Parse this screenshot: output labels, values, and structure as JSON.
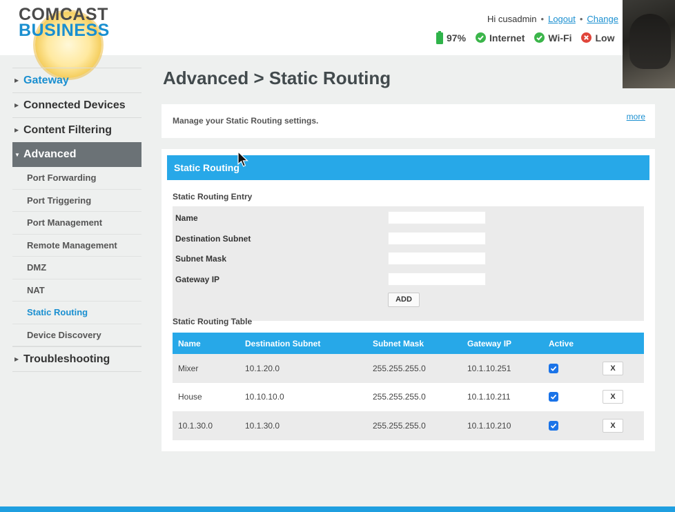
{
  "header": {
    "logo_line1": "COMCAST",
    "logo_line2": "BUSINESS",
    "greeting": "Hi cusadmin",
    "logout_label": "Logout",
    "change_label": "Change",
    "battery": "97%",
    "internet_label": "Internet",
    "wifi_label": "Wi-Fi",
    "low_label": "Low"
  },
  "sidebar": {
    "items": [
      {
        "label": "Gateway"
      },
      {
        "label": "Connected Devices"
      },
      {
        "label": "Content Filtering"
      },
      {
        "label": "Advanced"
      },
      {
        "label": "Troubleshooting"
      }
    ],
    "sub_items": [
      {
        "label": "Port Forwarding"
      },
      {
        "label": "Port Triggering"
      },
      {
        "label": "Port Management"
      },
      {
        "label": "Remote Management"
      },
      {
        "label": "DMZ"
      },
      {
        "label": "NAT"
      },
      {
        "label": "Static Routing"
      },
      {
        "label": "Device Discovery"
      }
    ]
  },
  "main": {
    "title": "Advanced > Static Routing",
    "description": "Manage your Static Routing settings.",
    "more_label": "more",
    "panel_title": "Static Routing",
    "entry_title": "Static Routing Entry",
    "fields": [
      {
        "label": "Name",
        "value": ""
      },
      {
        "label": "Destination Subnet",
        "value": ""
      },
      {
        "label": "Subnet Mask",
        "value": ""
      },
      {
        "label": "Gateway IP",
        "value": ""
      }
    ],
    "add_label": "ADD",
    "table_title": "Static Routing Table",
    "table": {
      "headers": [
        "Name",
        "Destination Subnet",
        "Subnet Mask",
        "Gateway IP",
        "Active"
      ],
      "delete_label": "X",
      "rows": [
        {
          "name": "Mixer",
          "dest": "10.1.20.0",
          "mask": "255.255.255.0",
          "gateway": "10.1.10.251",
          "active": true
        },
        {
          "name": "House",
          "dest": "10.10.10.0",
          "mask": "255.255.255.0",
          "gateway": "10.1.10.211",
          "active": true
        },
        {
          "name": "10.1.30.0",
          "dest": "10.1.30.0",
          "mask": "255.255.255.0",
          "gateway": "10.1.10.210",
          "active": true
        }
      ]
    }
  },
  "colors": {
    "accent": "#27a8e8",
    "link": "#1a8fd0",
    "nav_active": "#6b7276",
    "checkbox": "#1a73e8"
  }
}
